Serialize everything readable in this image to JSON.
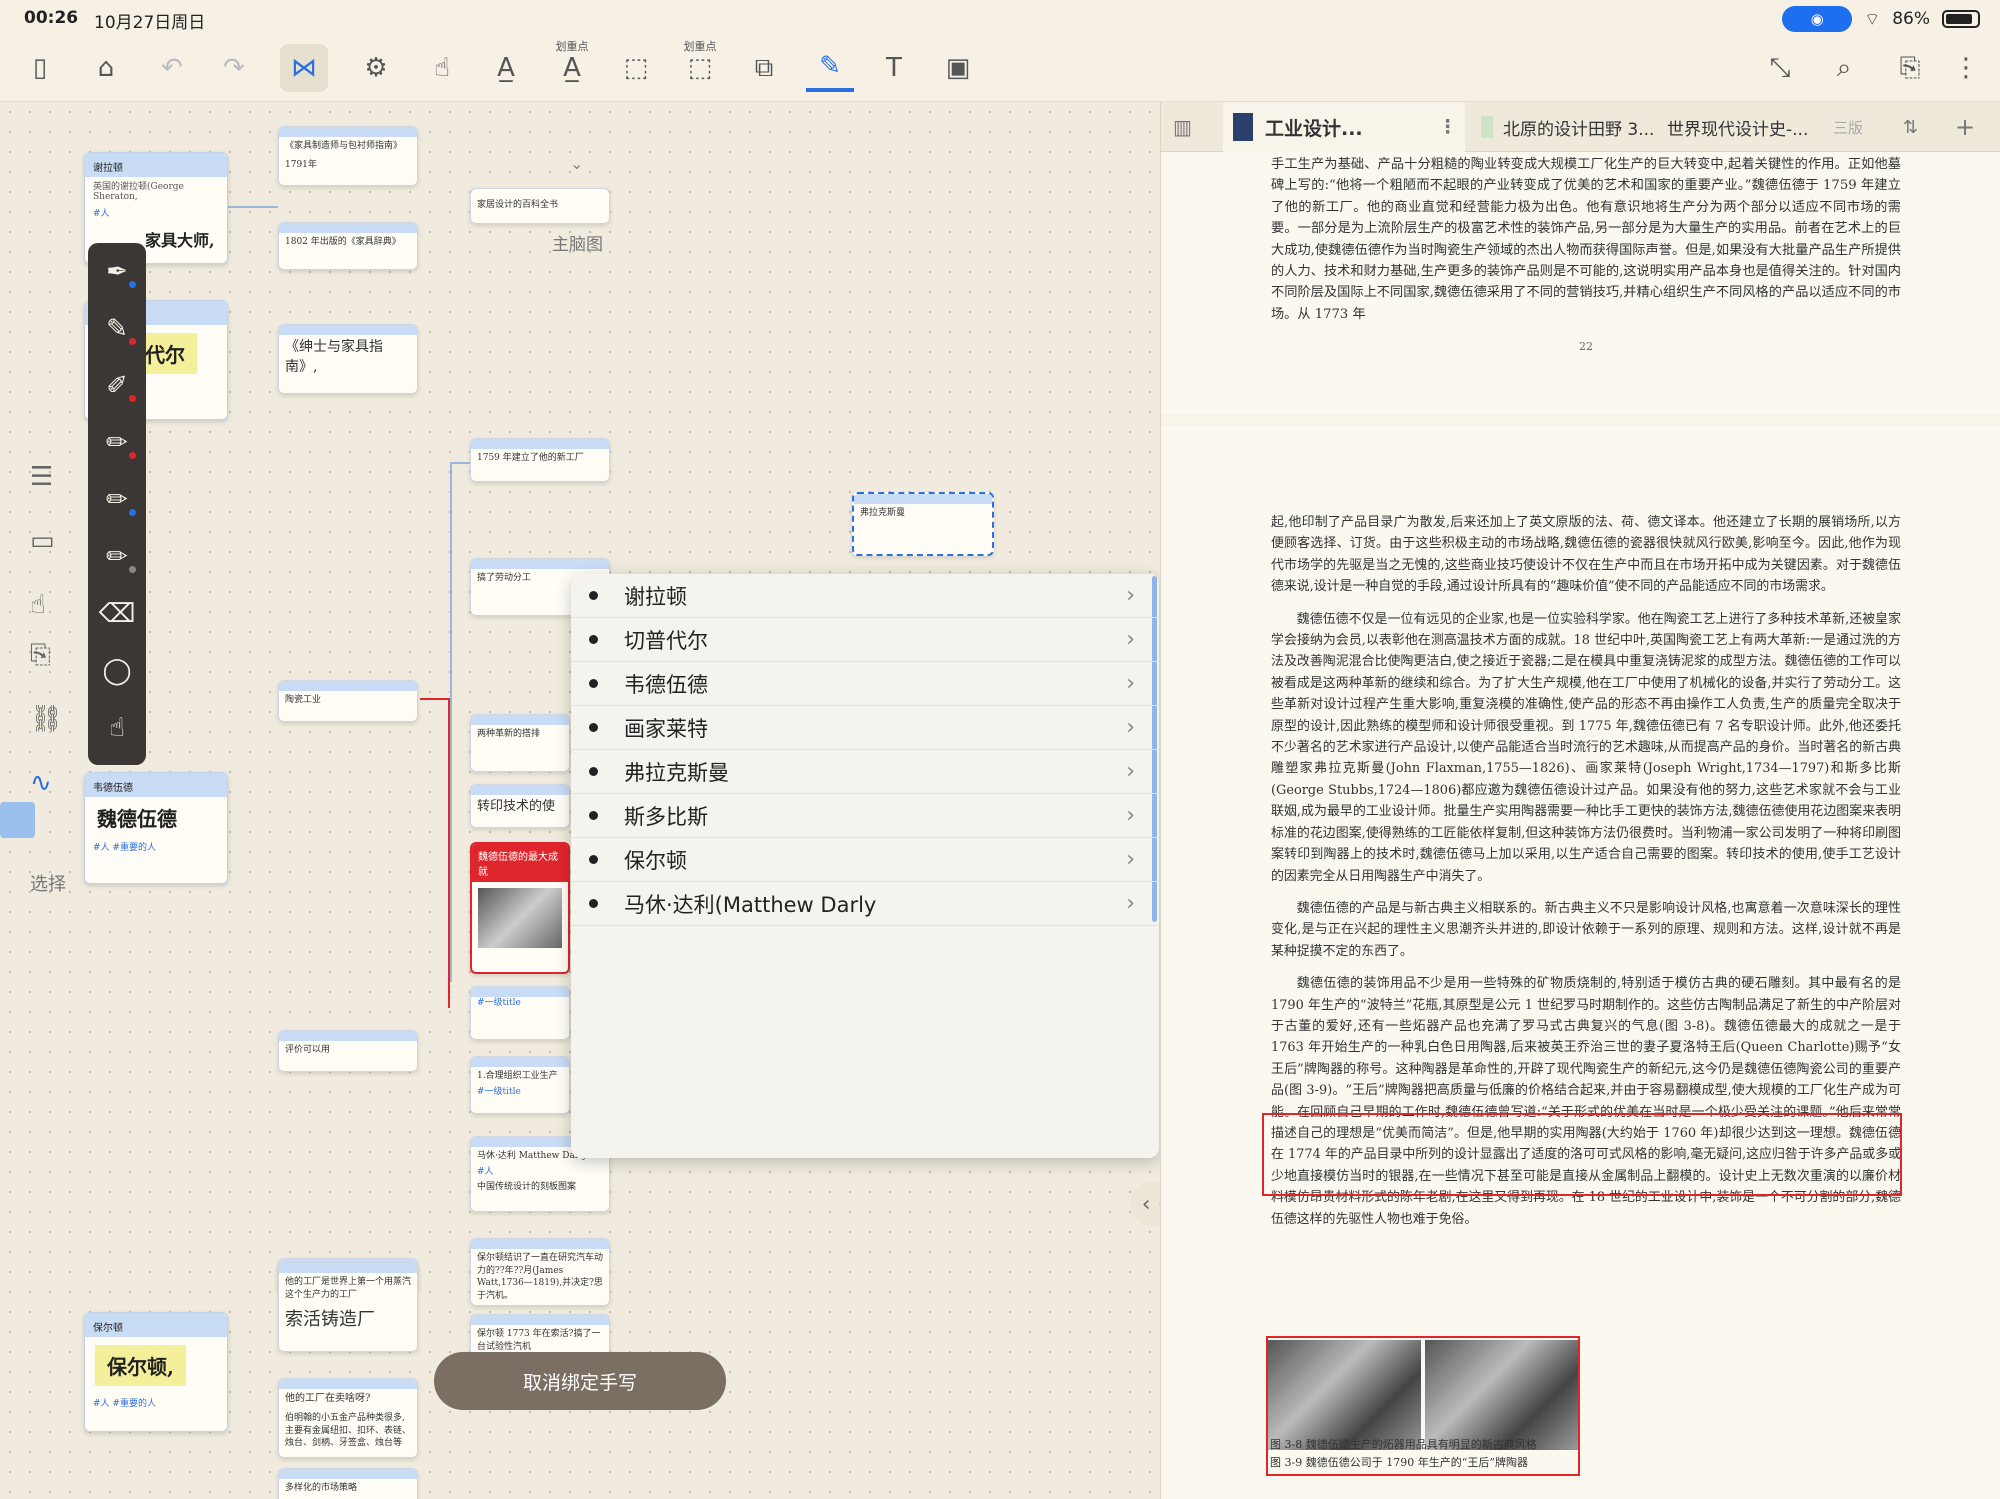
{
  "status": {
    "time": "00:26",
    "date": "10月27日周日",
    "battery": "86%"
  },
  "toolbar": {
    "sub_label_1": "划重点",
    "sub_label_2": "划重点"
  },
  "mindmap": {
    "title": "主脑图",
    "nodes": {
      "sheraton_hd": "谢拉顿",
      "sheraton_note": "英国的谢拉顿(George Sheraton,",
      "sheraton_tag": "#人",
      "sheraton_big": "家具大师,",
      "chippendale_big": "切普代尔",
      "wedgwood_hd": "韦德伍德",
      "wedgwood_big": "魏德伍德",
      "wedgwood_tag": "#人 #重要的人",
      "boulton_hd": "保尔顿",
      "boulton_big": "保尔顿,",
      "boulton_tag": "#人 #重要的人",
      "n_furniture_book": "《家具制造师与包衬师指南》",
      "n_1791": "1791年",
      "n_1802": "1802 年出版的《家具辞典》",
      "n_encyclopedia": "家居设计的百科全书",
      "n_gentleman": "《绅士与家具指南》,",
      "n_1759": "1759 年建立了他的新工厂",
      "n_division": "搞了劳动分工",
      "n_flaxman": "弗拉克斯曼",
      "n_pottery": "陶瓷工业",
      "n_two_changes": "两种革新的搭排",
      "n_transfer": "转印技术的使",
      "n_biggest": "魏德伍德的最大成就",
      "n_evaluate": "评价可以用",
      "n_title1": "#一级title",
      "n_reasonable": "1.合理组织工业生产",
      "n_title2": "#一级title",
      "n_darly": "马休·达利 Matthew Darly",
      "n_darly_tag": "#人",
      "n_darly_note": "中国传统设计的刻板图案",
      "n_his_factory": "他的工厂是世界上第一个用蒸汽这个生产力的工厂",
      "n_soho": "索活铸造厂",
      "n_watt": "保尔顿结识了一直在研究汽车动力的??年??月(James Watt,1736—1819),并决定?思于汽机。",
      "n_1773": "保尔顿 1773 年在索活?搞了一台试验性汽机",
      "n_selling": "他的工厂在卖啥呀?",
      "n_products": "伯明翰的小五金产品种类很多,主要有金属纽扣、扣环、表链、烛台、剑柄、牙签盒、烛台等",
      "n_diverse": "多样化的市场策略"
    }
  },
  "dropdown": {
    "items": [
      "谢拉顿",
      "切普代尔",
      "韦德伍德",
      "画家莱特",
      "弗拉克斯曼",
      "斯多比斯",
      "保尔顿",
      "马休·达利(Matthew Darly"
    ]
  },
  "side_tool": {
    "select_label": "选择"
  },
  "cancel_button": "取消绑定手写",
  "pdf": {
    "tabs": [
      "工业设计...",
      "北原的设计田野 3...",
      "世界现代设计史-...",
      "三版"
    ],
    "page22": [
      "手工生产为基础、产品十分粗糙的陶业转变成大规模工厂化生产的巨大转变中,起着关键性的作用。正如他墓碑上写的:“他将一个粗陋而不起眼的产业转变成了优美的艺术和国家的重要产业。”魏德伍德于 1759 年建立了他的新工厂。他的商业直觉和经营能力极为出色。他有意识地将生产分为两个部分以适应不同市场的需要。一部分是为上流阶层生产的极富艺术性的装饰产品,另一部分是为大量生产的实用品。前者在艺术上的巨大成功,使魏德伍德作为当时陶瓷生产领域的杰出人物而获得国际声誉。但是,如果没有大批量产品生产所提供的人力、技术和财力基础,生产更多的装饰产品则是不可能的,这说明实用产品本身也是值得关注的。针对国内不同阶层及国际上不同国家,魏德伍德采用了不同的营销技巧,并精心组织生产不同风格的产品以适应不同的市场。从 1773 年"
    ],
    "page22_num": "22",
    "page23": [
      "起,他印制了产品目录广为散发,后来还加上了英文原版的法、荷、德文译本。他还建立了长期的展销场所,以方便顾客选择、订货。由于这些积极主动的市场战略,魏德伍德的瓷器很快就风行欧美,影响至今。因此,他作为现代市场学的先驱是当之无愧的,这些商业技巧使设计不仅在生产中而且在市场开拓中成为关键因素。对于魏德伍德来说,设计是一种自觉的手段,通过设计所具有的“趣味价值”使不同的产品能适应不同的市场需求。",
      "魏德伍德不仅是一位有远见的企业家,也是一位实验科学家。他在陶瓷工艺上进行了多种技术革新,还被皇家学会接纳为会员,以表彰他在测高温技术方面的成就。18 世纪中叶,英国陶瓷工艺上有两大革新:一是通过洗的方法及改善陶泥混合比使陶更洁白,使之接近于瓷器;二是在模具中重复浇铸泥浆的成型方法。魏德伍德的工作可以被看成是这两种革新的继续和综合。为了扩大生产规模,他在工厂中使用了机械化的设备,并实行了劳动分工。这些革新对设计过程产生重大影响,重复浇模的准确性,使产品的形态不再由操作工人负责,生产的质量完全取决于原型的设计,因此熟练的模型师和设计师很受重视。到 1775 年,魏德伍德已有 7 名专职设计师。此外,他还委托不少著名的艺术家进行产品设计,以使产品能适合当时流行的艺术趣味,从而提高产品的身价。当时著名的新古典雕塑家弗拉克斯曼(John Flaxman,1755—1826)、画家莱特(Joseph Wright,1734—1797)和斯多比斯(George Stubbs,1724—1806)都应邀为魏德伍德设计过产品。如果没有他的努力,这些艺术家就不会与工业联姻,成为最早的工业设计师。批量生产实用陶器需要一种比手工更快的装饰方法,魏德伍德使用花边图案来表明标准的花边图案,使得熟练的工匠能依样复制,但这种装饰方法仍很费时。当利物浦一家公司发明了一种将印刷图案转印到陶器上的技术时,魏德伍德马上加以采用,以生产适合自己需要的图案。转印技术的使用,使手工艺设计的因素完全从日用陶器生产中消失了。",
      "魏德伍德的产品是与新古典主义相联系的。新古典主义不只是影响设计风格,也寓意着一次意味深长的理性变化,是与正在兴起的理性主义思潮齐头并进的,即设计依赖于一系列的原理、规则和方法。这样,设计就不再是某种捉摸不定的东西了。",
      "魏德伍德的装饰用品不少是用一些特殊的矿物质烧制的,特别适于模仿古典的硬石雕刻。其中最有名的是 1790 年生产的“波特兰”花瓶,其原型是公元 1 世纪罗马时期制作的。这些仿古陶制品满足了新生的中产阶层对于古董的爱好,还有一些炻器产品也充满了罗马式古典复兴的气息(图 3-8)。魏德伍德最大的成就之一是于 1763 年开始生产的一种乳白色日用陶器,后来被英王乔治三世的妻子夏洛特王后(Queen Charlotte)赐予“女王后”牌陶器的称号。这种陶器是革命性的,开辟了现代陶瓷生产的新纪元,这今仍是魏德伍德陶瓷公司的重要产品(图 3-9)。“王后”牌陶器把高质量与低廉的价格结合起来,并由于容易翻模成型,使大规模的工厂化生产成为可能。在回顾自己早期的工作时,魏德伍德曾写道:“关于形式的优美在当时是一个极少受关注的课题。”他后来常常描述自己的理想是“优美而简洁”。但是,他早期的实用陶器(大约始于 1760 年)却很少达到这一理想。魏德伍德在 1774 年的产品目录中所列的设计显露出了适度的洛可可式风格的影响,毫无疑问,这应归咎于许多产品或多或少地直接模仿当时的银器,在一些情况下甚至可能是直接从金属制品上翻模的。设计史上无数次重演的以廉价材料模仿昂贵材料形式的陈年老剧,在这里又得到再现。在 18 世纪的工业设计中,装饰是一个不可分割的部分,魏德伍德这样的先驱性人物也难于免俗。"
    ],
    "fig_caption_1": "图 3-8   魏德伍德生产的炻器用品具有明显的新古典风格",
    "fig_caption_2": "图 3-9   魏德伍德公司于 1790 年生产的“王后”牌陶器"
  },
  "colors": {
    "accent": "#2c6fe0",
    "highlight_red": "#e0262d",
    "node_header": "#c9dcf5"
  }
}
